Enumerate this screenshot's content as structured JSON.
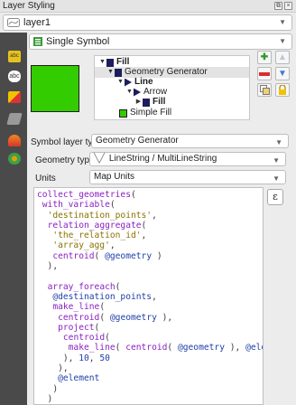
{
  "window": {
    "title": "Layer Styling"
  },
  "layer_select": {
    "value": "layer1"
  },
  "renderer": {
    "value": "Single Symbol"
  },
  "symbol_tree": [
    {
      "label": "Fill",
      "indent": 0,
      "bold": true,
      "color": "#1d1d5c"
    },
    {
      "label": "Geometry Generator",
      "indent": 1,
      "bold": false,
      "color": "#1d1d5c",
      "selected": true
    },
    {
      "label": "Line",
      "indent": 2,
      "bold": true,
      "color": "#1d1d5c"
    },
    {
      "label": "Arrow",
      "indent": 3,
      "bold": false,
      "color": "#1d1d5c"
    },
    {
      "label": "Fill",
      "indent": 4,
      "bold": true,
      "color": "#1d1d5c"
    },
    {
      "label": "Simple Fill",
      "indent": 2,
      "bold": false,
      "color": "#33cc00"
    }
  ],
  "symbol_layer_type": {
    "label": "Symbol layer type",
    "value": "Geometry Generator"
  },
  "geometry_type": {
    "label": "Geometry type",
    "value": "LineString / MultiLineString"
  },
  "units": {
    "label": "Units",
    "value": "Map Units"
  },
  "expression": [
    "collect_geometries(",
    " with_variable(",
    "  'destination_points',",
    "  relation_aggregate(",
    "   'the_relation_id',",
    "   'array_agg',",
    "   centroid( @geometry )",
    "  ),",
    "",
    "  array_foreach(",
    "   @destination_points,",
    "   make_line(",
    "    centroid( @geometry ),",
    "    project(",
    "     centroid(",
    "      make_line( centroid( @geometry ), @element )",
    "     ), 10, 50",
    "    ),",
    "    @element",
    "   )",
    "  )",
    " )",
    ")"
  ],
  "colors": {
    "accent_fill": "#33cc00",
    "symbol_dark": "#1d1d5c"
  }
}
